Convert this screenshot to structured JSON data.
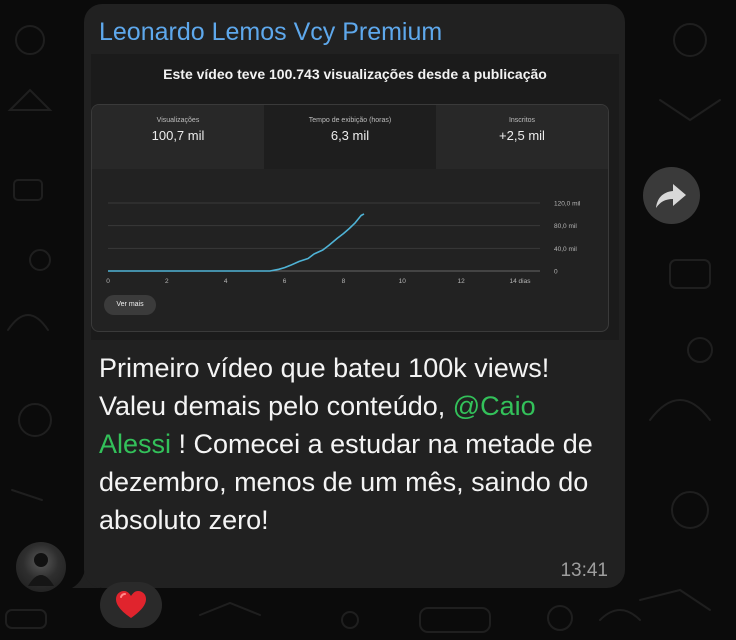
{
  "message": {
    "sender": "Leonardo Lemos Vcy Premium",
    "text_before": "Primeiro vídeo que bateu 100k views! Valeu demais pelo conteúdo, ",
    "mention": "@Caio Alessi",
    "text_after": " ! Comecei a estudar na metade de dezembro, menos de um mês, saindo do absoluto zero!",
    "time": "13:41"
  },
  "analytics": {
    "headline": "Este vídeo teve 100.743 visualizações desde a publicação",
    "metrics": [
      {
        "label": "Visualizações",
        "value": "100,7 mil"
      },
      {
        "label": "Tempo de exibição (horas)",
        "value": "6,3 mil"
      },
      {
        "label": "Inscritos",
        "value": "+2,5 mil"
      }
    ],
    "see_more": "Ver mais"
  },
  "chart_data": {
    "type": "line",
    "x_ticks": [
      "0",
      "2",
      "4",
      "6",
      "8",
      "10",
      "12",
      "14 dias"
    ],
    "y_ticks": [
      "0",
      "40,0 mil",
      "80,0 mil",
      "120,0 mil"
    ],
    "xlim": [
      0,
      14
    ],
    "ylim": [
      0,
      120000
    ],
    "grid": true,
    "line_color": "#4fb3d6",
    "series": [
      {
        "x": [
          0,
          1,
          2,
          3,
          4,
          5,
          5.5,
          5.8,
          6,
          6.2,
          6.5,
          6.8,
          7,
          7.3,
          7.5,
          7.8,
          8,
          8.2,
          8.4,
          8.6,
          8.7
        ],
        "y": [
          0,
          0,
          0,
          0,
          0,
          0,
          0,
          3000,
          6000,
          10000,
          17000,
          22000,
          30000,
          37000,
          45000,
          58000,
          66000,
          75000,
          85000,
          98000,
          100700
        ]
      }
    ]
  },
  "reaction": {
    "emoji": "❤️"
  },
  "colors": {
    "background": "#0b0b0b",
    "bubble": "#212121",
    "sender_name": "#5ea8ec",
    "mention": "#33c15a",
    "timestamp": "#9e9e9e"
  },
  "icons": [
    "forward-icon",
    "heart-icon",
    "avatar"
  ]
}
